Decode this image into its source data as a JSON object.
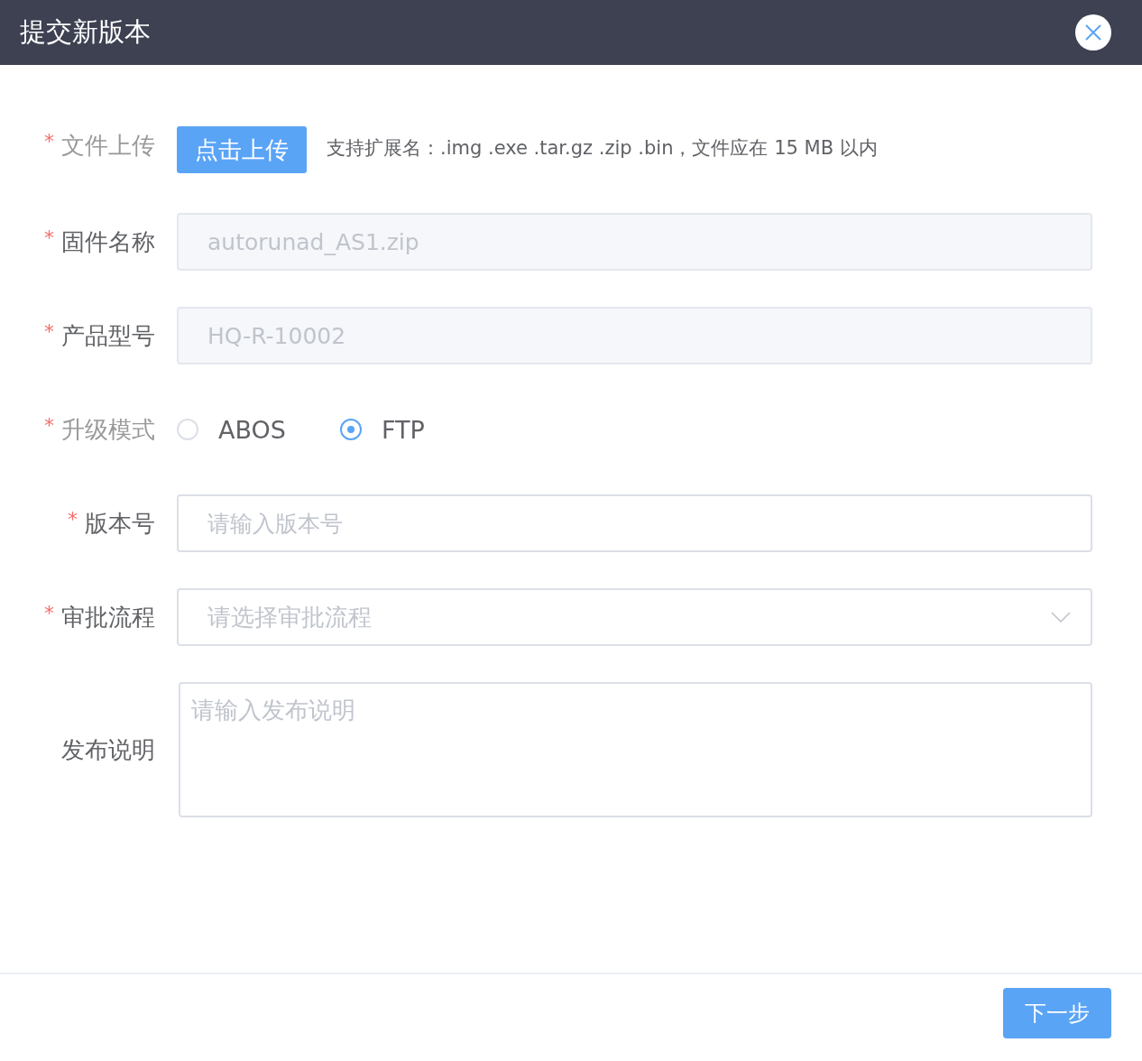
{
  "dialog": {
    "title": "提交新版本"
  },
  "fields": [
    {
      "kind": "upload",
      "label": "文件上传",
      "required_mark": "*",
      "button": "点击上传",
      "hint": "支持扩展名：.img .exe .tar.gz .zip .bin，文件应在 15 MB 以内"
    },
    {
      "kind": "input",
      "label": "固件名称",
      "required_mark": "*",
      "value": "autorunad_AS1.zip",
      "disabled": true
    },
    {
      "kind": "input",
      "label": "产品型号",
      "required_mark": "*",
      "value": "HQ-R-10002",
      "disabled": true
    },
    {
      "kind": "radio",
      "label": "升级模式",
      "required_mark": "*",
      "options": [
        {
          "label": "ABOS",
          "selected": false
        },
        {
          "label": "FTP",
          "selected": true
        }
      ]
    },
    {
      "kind": "input",
      "label": "版本号",
      "required_mark": "*",
      "placeholder": "请输入版本号"
    },
    {
      "kind": "select",
      "label": "审批流程",
      "required_mark": "*",
      "placeholder": "请选择审批流程"
    },
    {
      "kind": "textarea",
      "label": "发布说明",
      "placeholder": "请输入发布说明"
    }
  ],
  "footer": {
    "next_button": "下一步"
  }
}
